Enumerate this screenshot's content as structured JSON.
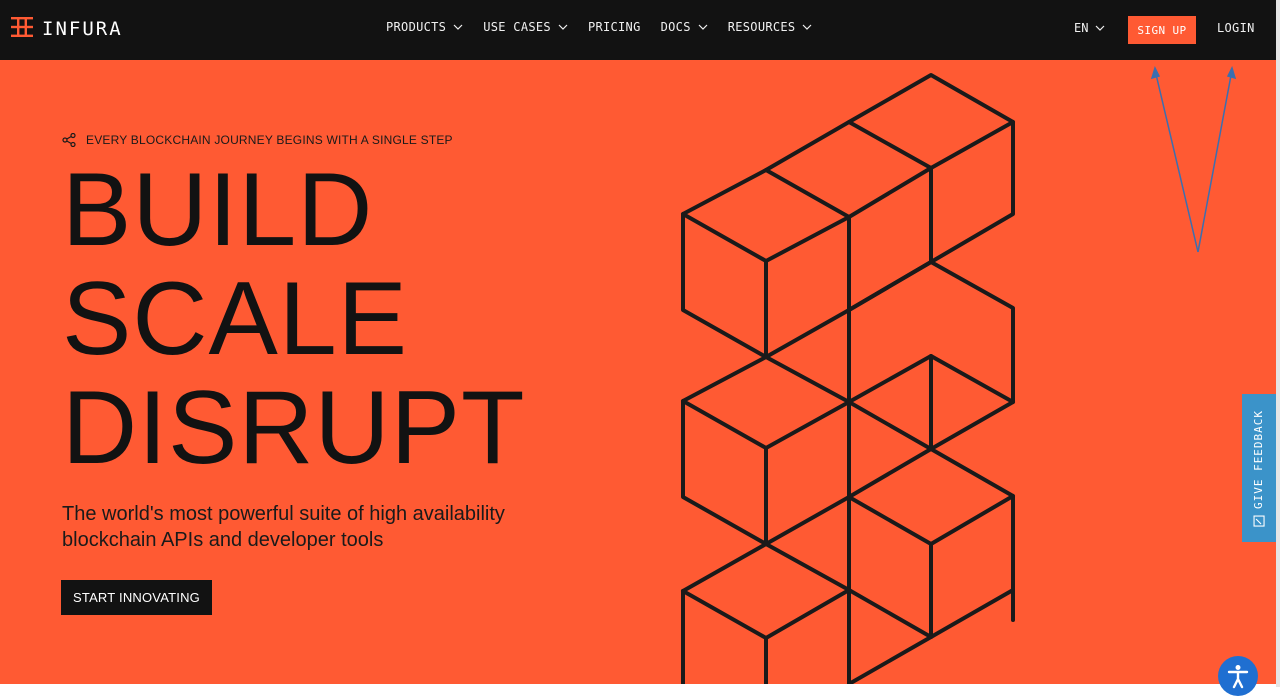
{
  "brand": {
    "name": "INFURA"
  },
  "nav": {
    "items": [
      {
        "label": "PRODUCTS",
        "has_dropdown": true
      },
      {
        "label": "USE CASES",
        "has_dropdown": true
      },
      {
        "label": "PRICING",
        "has_dropdown": false
      },
      {
        "label": "DOCS",
        "has_dropdown": true
      },
      {
        "label": "RESOURCES",
        "has_dropdown": true
      }
    ],
    "language": "EN",
    "signup_label": "SIGN UP",
    "login_label": "LOGIN"
  },
  "hero": {
    "eyebrow": "EVERY BLOCKCHAIN JOURNEY BEGINS WITH A SINGLE STEP",
    "headline": [
      "BUILD",
      "SCALE",
      "DISRUPT"
    ],
    "subtitle": "The world's most powerful suite of high availability blockchain APIs and developer tools",
    "cta_label": "START INNOVATING"
  },
  "feedback_tab": {
    "label": "GIVE FEEDBACK"
  },
  "icons": {
    "logo": "infura-logo-icon",
    "eyebrow": "share-nodes-icon",
    "dropdown": "chevron-down-icon",
    "feedback": "feedback-icon",
    "accessibility": "accessibility-icon"
  },
  "colors": {
    "nav_bg": "#121212",
    "hero_bg": "#ff5a33",
    "accent": "#ff5a33",
    "text_dark": "#121212",
    "feedback_bg": "#3b93c9",
    "accessibility_bg": "#1f6fd1"
  }
}
